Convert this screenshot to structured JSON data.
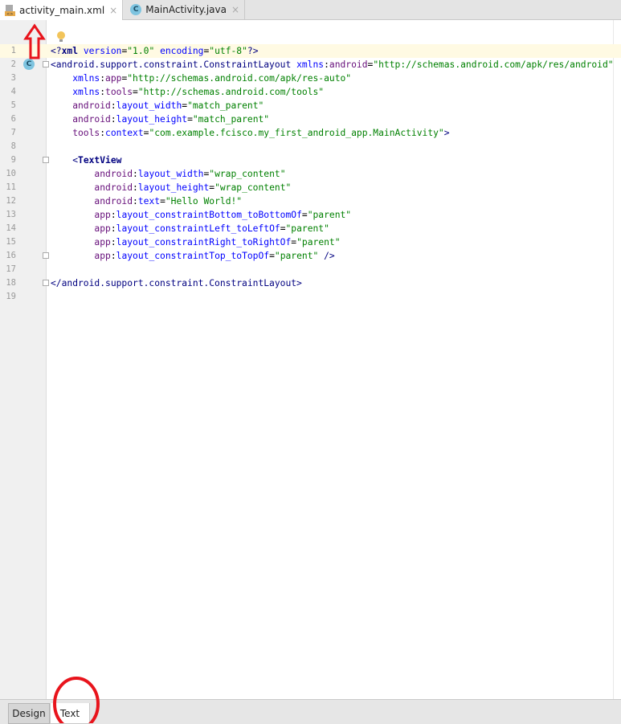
{
  "tabs": [
    {
      "label": "activity_main.xml",
      "active": true
    },
    {
      "label": "MainActivity.java",
      "active": false
    }
  ],
  "close_glyph": "×",
  "class_icon_letter": "C",
  "code_lines": [
    [
      {
        "t": "<?",
        "c": "tagn"
      },
      {
        "t": "xml ",
        "c": "tag"
      },
      {
        "t": "version",
        "c": "attr"
      },
      {
        "t": "=",
        "c": "pun"
      },
      {
        "t": "\"1.0\" ",
        "c": "val"
      },
      {
        "t": "encoding",
        "c": "attr"
      },
      {
        "t": "=",
        "c": "pun"
      },
      {
        "t": "\"utf-8\"",
        "c": "val"
      },
      {
        "t": "?>",
        "c": "tagn"
      }
    ],
    [
      {
        "t": "<android.support.constraint.ConstraintLayout ",
        "c": "tagn"
      },
      {
        "t": "xmlns",
        "c": "attr"
      },
      {
        "t": ":",
        "c": "pun"
      },
      {
        "t": "android",
        "c": "ns"
      },
      {
        "t": "=",
        "c": "pun"
      },
      {
        "t": "\"http://schemas.android.com/apk/res/android\"",
        "c": "val"
      }
    ],
    [
      {
        "t": "    xmlns",
        "c": "attr"
      },
      {
        "t": ":",
        "c": "pun"
      },
      {
        "t": "app",
        "c": "ns"
      },
      {
        "t": "=",
        "c": "pun"
      },
      {
        "t": "\"http://schemas.android.com/apk/res-auto\"",
        "c": "val"
      }
    ],
    [
      {
        "t": "    xmlns",
        "c": "attr"
      },
      {
        "t": ":",
        "c": "pun"
      },
      {
        "t": "tools",
        "c": "ns"
      },
      {
        "t": "=",
        "c": "pun"
      },
      {
        "t": "\"http://schemas.android.com/tools\"",
        "c": "val"
      }
    ],
    [
      {
        "t": "    android",
        "c": "ns"
      },
      {
        "t": ":",
        "c": "pun"
      },
      {
        "t": "layout_width",
        "c": "attr"
      },
      {
        "t": "=",
        "c": "pun"
      },
      {
        "t": "\"match_parent\"",
        "c": "val"
      }
    ],
    [
      {
        "t": "    android",
        "c": "ns"
      },
      {
        "t": ":",
        "c": "pun"
      },
      {
        "t": "layout_height",
        "c": "attr"
      },
      {
        "t": "=",
        "c": "pun"
      },
      {
        "t": "\"match_parent\"",
        "c": "val"
      }
    ],
    [
      {
        "t": "    tools",
        "c": "ns"
      },
      {
        "t": ":",
        "c": "pun"
      },
      {
        "t": "context",
        "c": "attr"
      },
      {
        "t": "=",
        "c": "pun"
      },
      {
        "t": "\"com.example.fcisco.my_first_android_app.MainActivity\"",
        "c": "val"
      },
      {
        "t": ">",
        "c": "tagn"
      }
    ],
    [],
    [
      {
        "t": "    <",
        "c": "tagn"
      },
      {
        "t": "TextView",
        "c": "tag"
      }
    ],
    [
      {
        "t": "        android",
        "c": "ns"
      },
      {
        "t": ":",
        "c": "pun"
      },
      {
        "t": "layout_width",
        "c": "attr"
      },
      {
        "t": "=",
        "c": "pun"
      },
      {
        "t": "\"wrap_content\"",
        "c": "val"
      }
    ],
    [
      {
        "t": "        android",
        "c": "ns"
      },
      {
        "t": ":",
        "c": "pun"
      },
      {
        "t": "layout_height",
        "c": "attr"
      },
      {
        "t": "=",
        "c": "pun"
      },
      {
        "t": "\"wrap_content\"",
        "c": "val"
      }
    ],
    [
      {
        "t": "        android",
        "c": "ns"
      },
      {
        "t": ":",
        "c": "pun"
      },
      {
        "t": "text",
        "c": "attr"
      },
      {
        "t": "=",
        "c": "pun"
      },
      {
        "t": "\"Hello World!\"",
        "c": "val"
      }
    ],
    [
      {
        "t": "        app",
        "c": "ns"
      },
      {
        "t": ":",
        "c": "pun"
      },
      {
        "t": "layout_constraintBottom_toBottomOf",
        "c": "attr"
      },
      {
        "t": "=",
        "c": "pun"
      },
      {
        "t": "\"parent\"",
        "c": "val"
      }
    ],
    [
      {
        "t": "        app",
        "c": "ns"
      },
      {
        "t": ":",
        "c": "pun"
      },
      {
        "t": "layout_constraintLeft_toLeftOf",
        "c": "attr"
      },
      {
        "t": "=",
        "c": "pun"
      },
      {
        "t": "\"parent\"",
        "c": "val"
      }
    ],
    [
      {
        "t": "        app",
        "c": "ns"
      },
      {
        "t": ":",
        "c": "pun"
      },
      {
        "t": "layout_constraintRight_toRightOf",
        "c": "attr"
      },
      {
        "t": "=",
        "c": "pun"
      },
      {
        "t": "\"parent\"",
        "c": "val"
      }
    ],
    [
      {
        "t": "        app",
        "c": "ns"
      },
      {
        "t": ":",
        "c": "pun"
      },
      {
        "t": "layout_constraintTop_toTopOf",
        "c": "attr"
      },
      {
        "t": "=",
        "c": "pun"
      },
      {
        "t": "\"parent\" ",
        "c": "val"
      },
      {
        "t": "/>",
        "c": "tagn"
      }
    ],
    [],
    [
      {
        "t": "</android.support.constraint.ConstraintLayout>",
        "c": "tagn"
      }
    ],
    []
  ],
  "bottom_tabs": [
    {
      "label": "Design",
      "active": false
    },
    {
      "label": "Text",
      "active": true
    }
  ],
  "colors": {
    "annotation": "#e8141c",
    "current_line": "#fffae3"
  }
}
